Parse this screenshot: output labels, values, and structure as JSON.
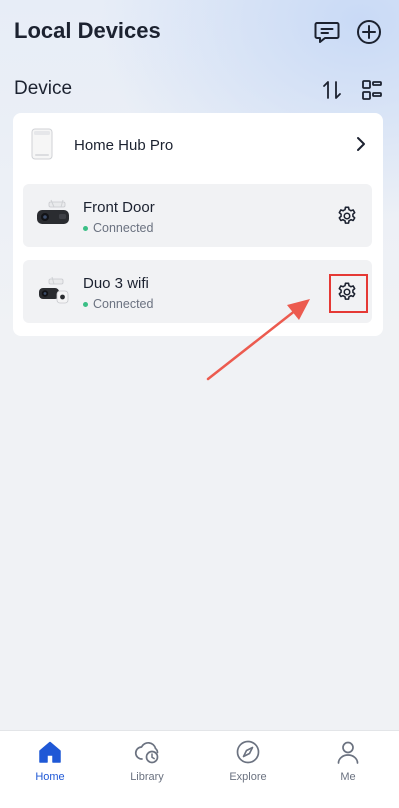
{
  "header": {
    "title": "Local Devices",
    "icons": [
      "message-icon",
      "add-circle-icon"
    ]
  },
  "section": {
    "title": "Device",
    "icons": [
      "sort-icon",
      "grid-view-icon"
    ]
  },
  "hub": {
    "name": "Home Hub Pro"
  },
  "devices": [
    {
      "name": "Front Door",
      "status": "Connected"
    },
    {
      "name": "Duo 3 wifi",
      "status": "Connected"
    }
  ],
  "colors": {
    "accent": "#1f58d6",
    "connected": "#3bbf86",
    "highlight": "#e53935"
  },
  "tabs": [
    {
      "label": "Home",
      "icon": "home-icon",
      "active": true
    },
    {
      "label": "Library",
      "icon": "cloud-clock-icon",
      "active": false
    },
    {
      "label": "Explore",
      "icon": "compass-icon",
      "active": false
    },
    {
      "label": "Me",
      "icon": "person-icon",
      "active": false
    }
  ]
}
